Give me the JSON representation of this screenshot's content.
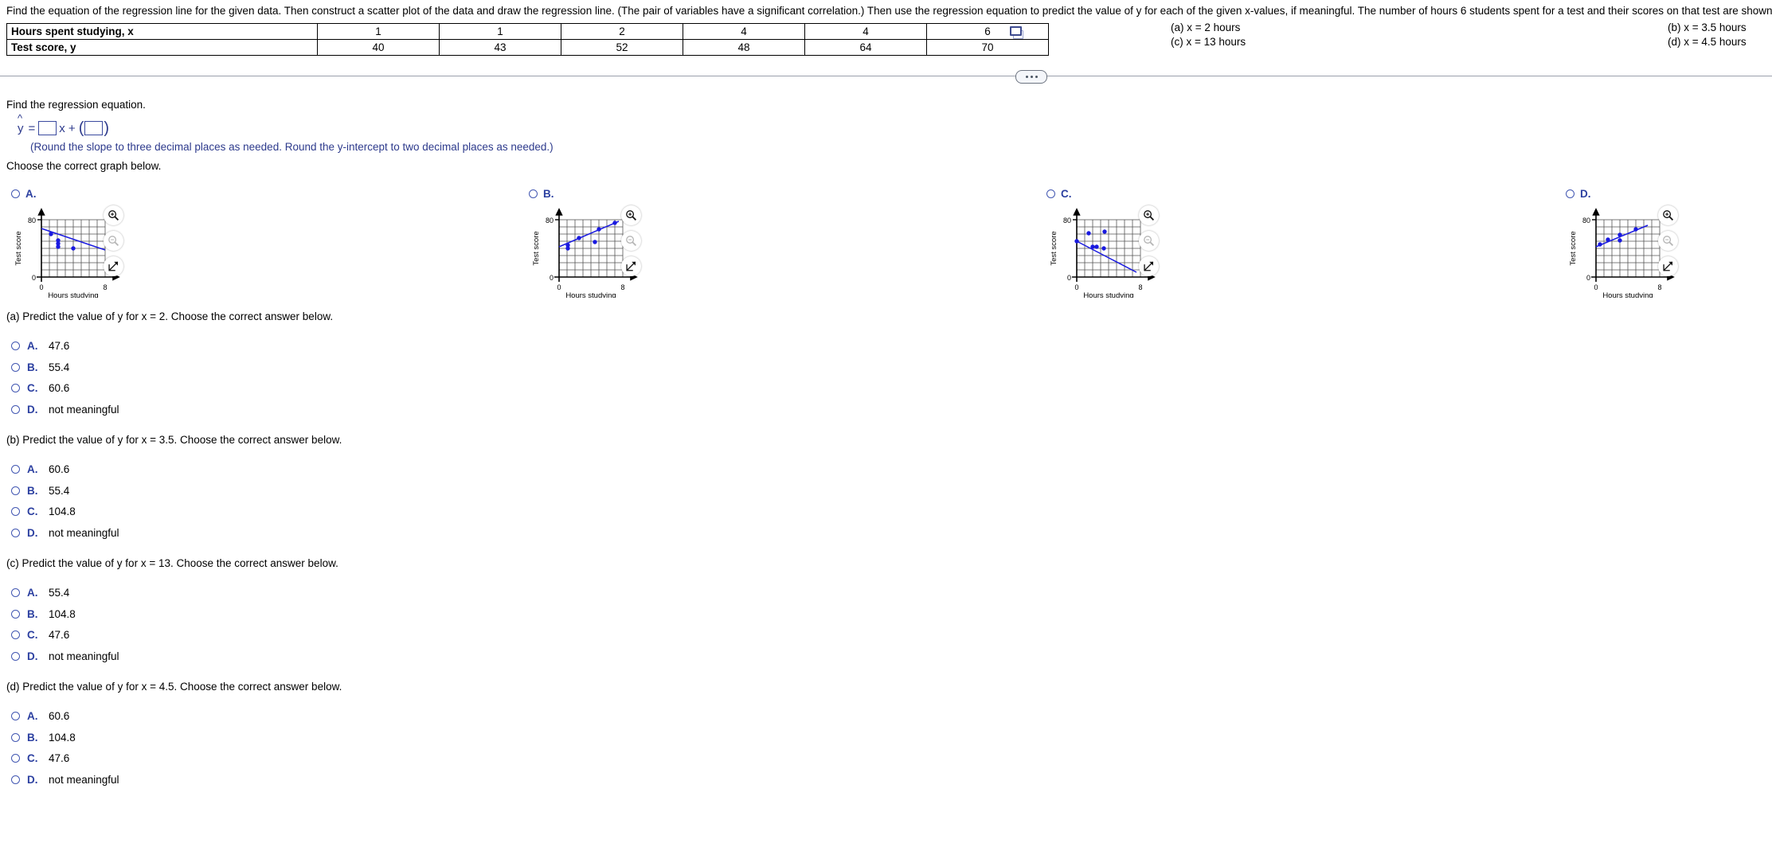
{
  "problem": {
    "stem": "Find the equation of the regression line for the given data. Then construct a scatter plot of the data and draw the regression line. (The pair of variables have a significant correlation.) Then use the regression equation to predict the value of y for each of the given x-values, if meaningful. The number of hours 6 students spent for a test and their scores on that test are shown below."
  },
  "table": {
    "row_labels": [
      "Hours spent studying, x",
      "Test score, y"
    ],
    "x_values": [
      "1",
      "1",
      "2",
      "4",
      "4",
      "6"
    ],
    "y_values": [
      "40",
      "43",
      "52",
      "48",
      "64",
      "70"
    ],
    "copy_icon": "copy-icon"
  },
  "hints": {
    "a": "(a) x = 2 hours",
    "b": "(b) x = 3.5 hours",
    "c": "(c) x = 13 hours",
    "d": "(d) x = 4.5 hours"
  },
  "divider": {
    "dots": "collapse-dots"
  },
  "regression": {
    "prompt": "Find the regression equation.",
    "yhat_label": "y",
    "hat": "^",
    "equals": "=",
    "x_term": "x +",
    "slope_value": "",
    "intercept_value": "",
    "round_note": "(Round the slope to three decimal places as needed. Round the y-intercept to two decimal places as needed.)"
  },
  "graph_prompt": "Choose the correct graph below.",
  "graph_choices": [
    {
      "key": "A.",
      "selected": false,
      "xlabel": "Hours studying",
      "ylabel": "Test score",
      "x_ticks": [
        "0",
        "8"
      ],
      "y_ticks": [
        "0",
        "80"
      ],
      "tools": [
        "zoom-in-icon",
        "zoom-out-icon",
        "expand-icon"
      ]
    },
    {
      "key": "B.",
      "selected": false,
      "xlabel": "Hours studying",
      "ylabel": "Test score",
      "x_ticks": [
        "0",
        "8"
      ],
      "y_ticks": [
        "0",
        "80"
      ],
      "tools": [
        "zoom-in-icon",
        "zoom-out-icon",
        "expand-icon"
      ]
    },
    {
      "key": "C.",
      "selected": false,
      "xlabel": "Hours studying",
      "ylabel": "Test score",
      "x_ticks": [
        "0",
        "8"
      ],
      "y_ticks": [
        "0",
        "80"
      ],
      "tools": [
        "zoom-in-icon",
        "zoom-out-icon",
        "expand-icon"
      ]
    },
    {
      "key": "D.",
      "selected": false,
      "xlabel": "Hours studying",
      "ylabel": "Test score",
      "x_ticks": [
        "0",
        "8"
      ],
      "y_ticks": [
        "0",
        "80"
      ],
      "tools": [
        "zoom-in-icon",
        "zoom-out-icon",
        "expand-icon"
      ]
    }
  ],
  "parts": [
    {
      "prompt": "(a) Predict the value of y for x = 2. Choose the correct answer below.",
      "options": [
        {
          "key": "A.",
          "value": "47.6"
        },
        {
          "key": "B.",
          "value": "55.4"
        },
        {
          "key": "C.",
          "value": "60.6"
        },
        {
          "key": "D.",
          "value": "not meaningful"
        }
      ]
    },
    {
      "prompt": "(b) Predict the value of y for x = 3.5. Choose the correct answer below.",
      "options": [
        {
          "key": "A.",
          "value": "60.6"
        },
        {
          "key": "B.",
          "value": "55.4"
        },
        {
          "key": "C.",
          "value": "104.8"
        },
        {
          "key": "D.",
          "value": "not meaningful"
        }
      ]
    },
    {
      "prompt": "(c) Predict the value of y for x = 13. Choose the correct answer below.",
      "options": [
        {
          "key": "A.",
          "value": "55.4"
        },
        {
          "key": "B.",
          "value": "104.8"
        },
        {
          "key": "C.",
          "value": "47.6"
        },
        {
          "key": "D.",
          "value": "not meaningful"
        }
      ]
    },
    {
      "prompt": "(d) Predict the value of y for x = 4.5. Choose the correct answer below.",
      "options": [
        {
          "key": "A.",
          "value": "60.6"
        },
        {
          "key": "B.",
          "value": "104.8"
        },
        {
          "key": "C.",
          "value": "47.6"
        },
        {
          "key": "D.",
          "value": "not meaningful"
        }
      ]
    }
  ],
  "chart_data": [
    {
      "type": "scatter",
      "id": "graph-A",
      "title": "A.",
      "xlabel": "Hours studying",
      "ylabel": "Test score",
      "xlim": [
        0,
        8
      ],
      "ylim": [
        0,
        80
      ],
      "grid": true,
      "points": [
        [
          1,
          64
        ],
        [
          2,
          55
        ],
        [
          2,
          50
        ],
        [
          2,
          52
        ],
        [
          4,
          47
        ]
      ],
      "line": {
        "from": [
          0,
          68
        ],
        "to": [
          8,
          38
        ]
      }
    },
    {
      "type": "scatter",
      "id": "graph-B",
      "title": "B.",
      "xlabel": "Hours studying",
      "ylabel": "Test score",
      "xlim": [
        0,
        8
      ],
      "ylim": [
        0,
        80
      ],
      "grid": true,
      "points": [
        [
          1,
          45
        ],
        [
          1,
          42
        ],
        [
          2.5,
          57
        ],
        [
          4.5,
          50
        ],
        [
          5,
          67
        ],
        [
          7,
          75
        ]
      ],
      "line": {
        "from": [
          0,
          42
        ],
        "to": [
          7.5,
          77
        ]
      }
    },
    {
      "type": "scatter",
      "id": "graph-C",
      "title": "C.",
      "xlabel": "Hours studying",
      "ylabel": "Test score",
      "xlim": [
        0,
        8
      ],
      "ylim": [
        0,
        80
      ],
      "grid": true,
      "points": [
        [
          0,
          52
        ],
        [
          1.5,
          64
        ],
        [
          2,
          48
        ],
        [
          2.5,
          48
        ],
        [
          3,
          46
        ],
        [
          3.5,
          66
        ]
      ],
      "line": {
        "from": [
          0,
          52
        ],
        "to": [
          7,
          8
        ]
      }
    },
    {
      "type": "scatter",
      "id": "graph-D",
      "title": "D.",
      "xlabel": "Hours studying",
      "ylabel": "Test score",
      "xlim": [
        0,
        8
      ],
      "ylim": [
        0,
        80
      ],
      "grid": true,
      "points": [
        [
          0.5,
          46
        ],
        [
          1.5,
          53
        ],
        [
          3,
          52
        ],
        [
          3,
          60
        ],
        [
          5,
          66
        ]
      ],
      "line": {
        "from": [
          0,
          43
        ],
        "to": [
          6.5,
          72
        ]
      }
    }
  ]
}
